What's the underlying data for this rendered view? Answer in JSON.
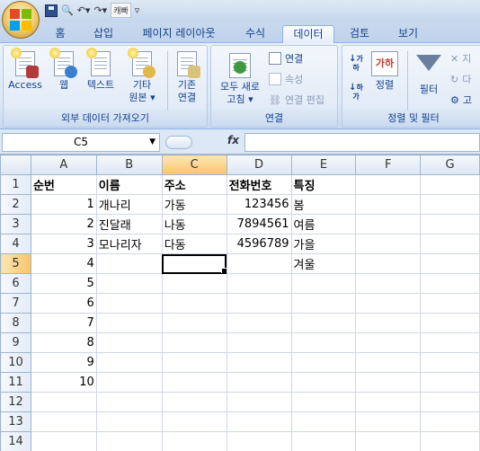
{
  "qat": {
    "label": "캐빠"
  },
  "tabs": [
    {
      "label": "홈",
      "active": false
    },
    {
      "label": "삽입",
      "active": false
    },
    {
      "label": "페이지 레이아웃",
      "active": false
    },
    {
      "label": "수식",
      "active": false
    },
    {
      "label": "데이터",
      "active": true
    },
    {
      "label": "검토",
      "active": false
    },
    {
      "label": "보기",
      "active": false
    }
  ],
  "ribbon": {
    "external": {
      "access": "Access",
      "web": "웹",
      "text": "텍스트",
      "other_1": "기타",
      "other_2": "원본",
      "existing_1": "기존",
      "existing_2": "연결",
      "group_label": "외부 데이터 가져오기"
    },
    "connections": {
      "refresh_1": "모두 새로",
      "refresh_2": "고침",
      "connections": "연결",
      "properties": "속성",
      "edit_links": "연결 편집",
      "group_label": "연결"
    },
    "sort_filter": {
      "sort": "정렬",
      "filter": "필터",
      "clear": "지",
      "reapply": "다",
      "advanced": "고",
      "group_label": "정렬 및 필터"
    }
  },
  "formula_bar": {
    "name_box": "C5",
    "fx": "fx",
    "value": ""
  },
  "columns": [
    "A",
    "B",
    "C",
    "D",
    "E",
    "F",
    "G"
  ],
  "rows": [
    {
      "n": "1",
      "cells": [
        "순번",
        "이름",
        "주소",
        "전화번호",
        "특징",
        "",
        ""
      ]
    },
    {
      "n": "2",
      "cells": [
        "1",
        "개나리",
        "가동",
        "123456",
        "봄",
        "",
        ""
      ]
    },
    {
      "n": "3",
      "cells": [
        "2",
        "진달래",
        "나동",
        "7894561",
        "여름",
        "",
        ""
      ]
    },
    {
      "n": "4",
      "cells": [
        "3",
        "모나리자",
        "다동",
        "4596789",
        "가을",
        "",
        ""
      ]
    },
    {
      "n": "5",
      "cells": [
        "4",
        "",
        "",
        "",
        "겨울",
        "",
        ""
      ]
    },
    {
      "n": "6",
      "cells": [
        "5",
        "",
        "",
        "",
        "",
        "",
        ""
      ]
    },
    {
      "n": "7",
      "cells": [
        "6",
        "",
        "",
        "",
        "",
        "",
        ""
      ]
    },
    {
      "n": "8",
      "cells": [
        "7",
        "",
        "",
        "",
        "",
        "",
        ""
      ]
    },
    {
      "n": "9",
      "cells": [
        "8",
        "",
        "",
        "",
        "",
        "",
        ""
      ]
    },
    {
      "n": "10",
      "cells": [
        "9",
        "",
        "",
        "",
        "",
        "",
        ""
      ]
    },
    {
      "n": "11",
      "cells": [
        "10",
        "",
        "",
        "",
        "",
        "",
        ""
      ]
    },
    {
      "n": "12",
      "cells": [
        "",
        "",
        "",
        "",
        "",
        "",
        ""
      ]
    },
    {
      "n": "13",
      "cells": [
        "",
        "",
        "",
        "",
        "",
        "",
        ""
      ]
    },
    {
      "n": "14",
      "cells": [
        "",
        "",
        "",
        "",
        "",
        "",
        ""
      ]
    }
  ],
  "active_cell": "C5"
}
